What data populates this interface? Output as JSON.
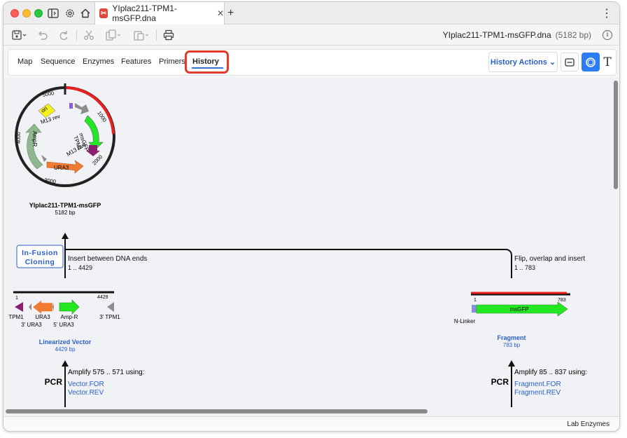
{
  "titlebar": {
    "tab_title": "YIplac211-TPM1-msGFP.dna",
    "close_glyph": "✕",
    "new_tab_glyph": "+",
    "more_glyph": "⋮"
  },
  "toolbar": {
    "file_name": "YIplac211-TPM1-msGFP.dna",
    "file_size": "(5182 bp)"
  },
  "view_tabs": [
    {
      "label": "Map"
    },
    {
      "label": "Sequence"
    },
    {
      "label": "Enzymes"
    },
    {
      "label": "Features"
    },
    {
      "label": "Primers"
    },
    {
      "label": "History"
    }
  ],
  "history_actions": {
    "label": "History Actions ⌄"
  },
  "plasmid": {
    "name": "YIplac211-TPM1-msGFP",
    "size": "5182 bp",
    "ticks": [
      "1000",
      "2000",
      "3000",
      "4000",
      "5000"
    ],
    "features": [
      "ori",
      "M13 rev",
      "msGFP",
      "TPM1",
      "M13 fwd",
      "AmpR",
      "URA3"
    ]
  },
  "infusion": {
    "label_line1": "In-Fusion",
    "label_line2": "Cloning",
    "left_desc": "Insert between DNA ends",
    "left_range": "1 .. 4429",
    "right_desc": "Flip, overlap and insert",
    "right_range": "1 .. 783"
  },
  "vector": {
    "name": "Linearized Vector",
    "size": "4429 bp",
    "start": "1",
    "end": "4429",
    "labels": [
      "TPM1",
      "3' URA3",
      "URA3",
      "5' URA3",
      "Amp-R",
      "3' TPM1"
    ]
  },
  "fragment": {
    "name": "Fragment",
    "size": "783 bp",
    "start": "1",
    "end": "783",
    "feature": "msGFP",
    "linker": "N-Linker"
  },
  "pcr_left": {
    "label": "PCR",
    "desc": "Amplify 575 .. 571 using:",
    "primer1": "Vector.FOR",
    "primer2": "Vector.REV"
  },
  "pcr_right": {
    "label": "PCR",
    "desc": "Amplify 85 .. 837 using:",
    "primer1": "Fragment.FOR",
    "primer2": "Fragment.REV"
  },
  "status": {
    "text": "Lab Enzymes"
  },
  "colors": {
    "accent": "#2b7cf6",
    "link": "#2a5fcc",
    "highlight": "#e23b2a",
    "msgfp": "#22e822"
  }
}
